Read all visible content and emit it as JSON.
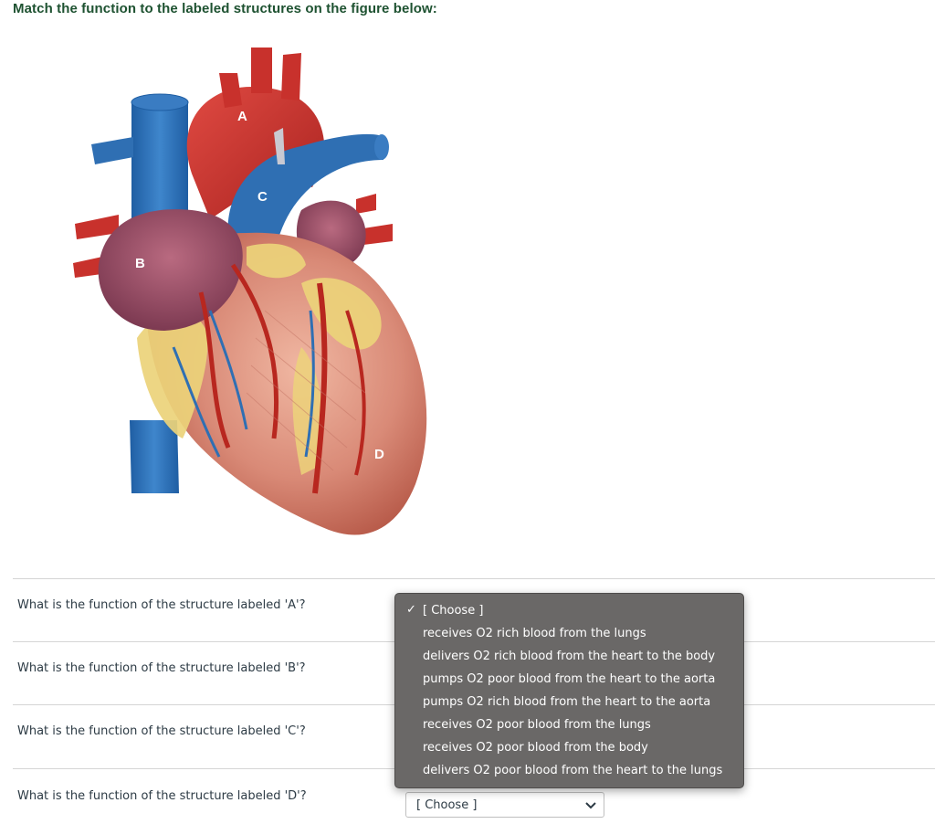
{
  "question": {
    "title": "Match the function to the labeled structures on the figure below:"
  },
  "figure": {
    "labels": {
      "a": "A",
      "b": "B",
      "c": "C",
      "d": "D"
    }
  },
  "rows": [
    {
      "prompt": "What is the function of the structure labeled 'A'?"
    },
    {
      "prompt": "What is the function of the structure labeled 'B'?"
    },
    {
      "prompt": "What is the function of the structure labeled 'C'?"
    },
    {
      "prompt": "What is the function of the structure labeled 'D'?",
      "selected": "[ Choose ]"
    }
  ],
  "dropdown": {
    "checkmark": "✓",
    "options": [
      "[ Choose ]",
      "receives O2 rich blood from the lungs",
      "delivers O2 rich blood from the heart to the body",
      "pumps O2 poor blood from the heart to the aorta",
      "pumps O2 rich blood from the heart to the aorta",
      "receives O2 poor blood from the lungs",
      "receives O2 poor blood from the body",
      "delivers O2 poor blood from the heart to the lungs"
    ]
  },
  "colors": {
    "title": "#1e5231",
    "dropdown_bg": "#6a6867",
    "artery_red": "#c8312c",
    "vein_blue": "#2f6fb3",
    "atrium_purple": "#9a5268",
    "muscle": "#d98a77",
    "fat_yellow": "#ecd27a"
  }
}
